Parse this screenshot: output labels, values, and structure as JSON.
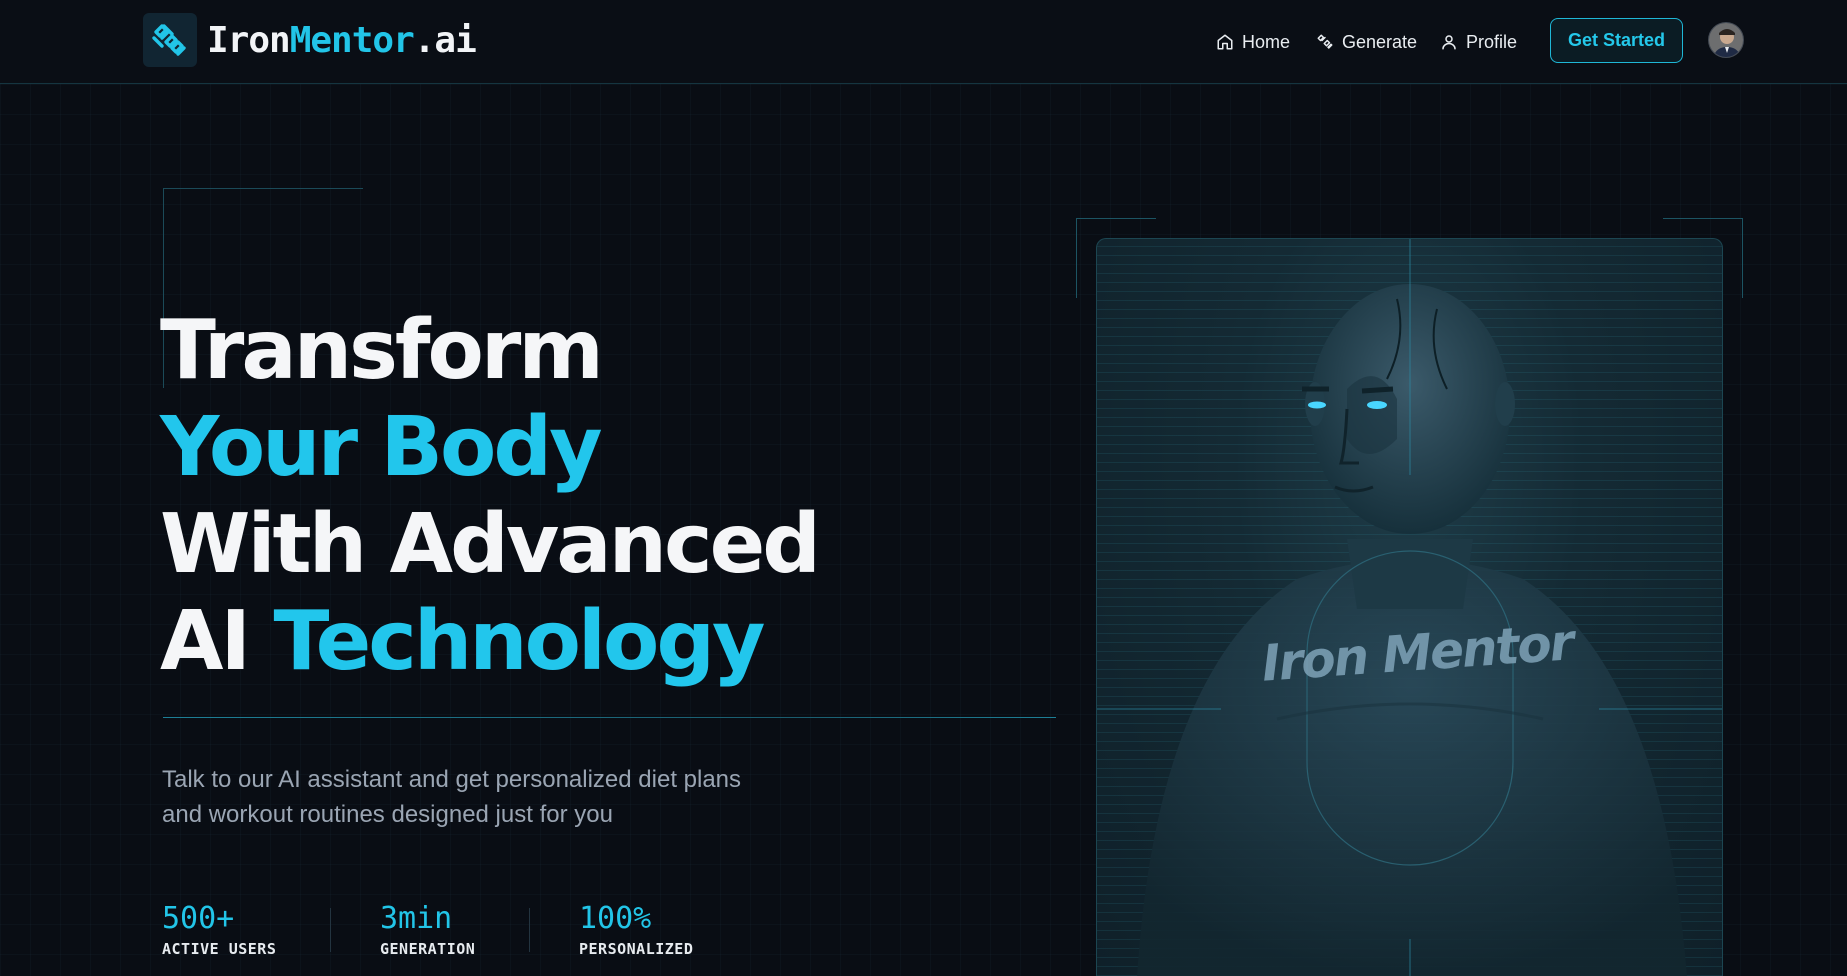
{
  "brand": {
    "name_part1": "Iron",
    "name_part2": "Mentor",
    "name_part3": ".ai",
    "logo_icon": "dumbbell-icon"
  },
  "nav": {
    "items": [
      {
        "label": "Home",
        "icon": "home-icon"
      },
      {
        "label": "Generate",
        "icon": "dumbbell-icon"
      },
      {
        "label": "Profile",
        "icon": "user-icon"
      }
    ],
    "cta_label": "Get Started"
  },
  "hero": {
    "line1": "Transform",
    "line2": "Your Body",
    "line3": "With Advanced",
    "line4_white": "AI",
    "line4_cyan": "Technology",
    "subtitle": "Talk to our AI assistant and get personalized diet plans and workout routines designed just for you",
    "stats": [
      {
        "value": "500+",
        "label": "ACTIVE USERS"
      },
      {
        "value": "3min",
        "label": "GENERATION"
      },
      {
        "value": "100%",
        "label": "PERSONALIZED"
      }
    ]
  },
  "card": {
    "overlay_text": "Iron Mentor"
  },
  "colors": {
    "accent": "#22c5e8",
    "background": "#090d14",
    "text": "#f2f4f7",
    "muted": "#9aa5b3"
  }
}
